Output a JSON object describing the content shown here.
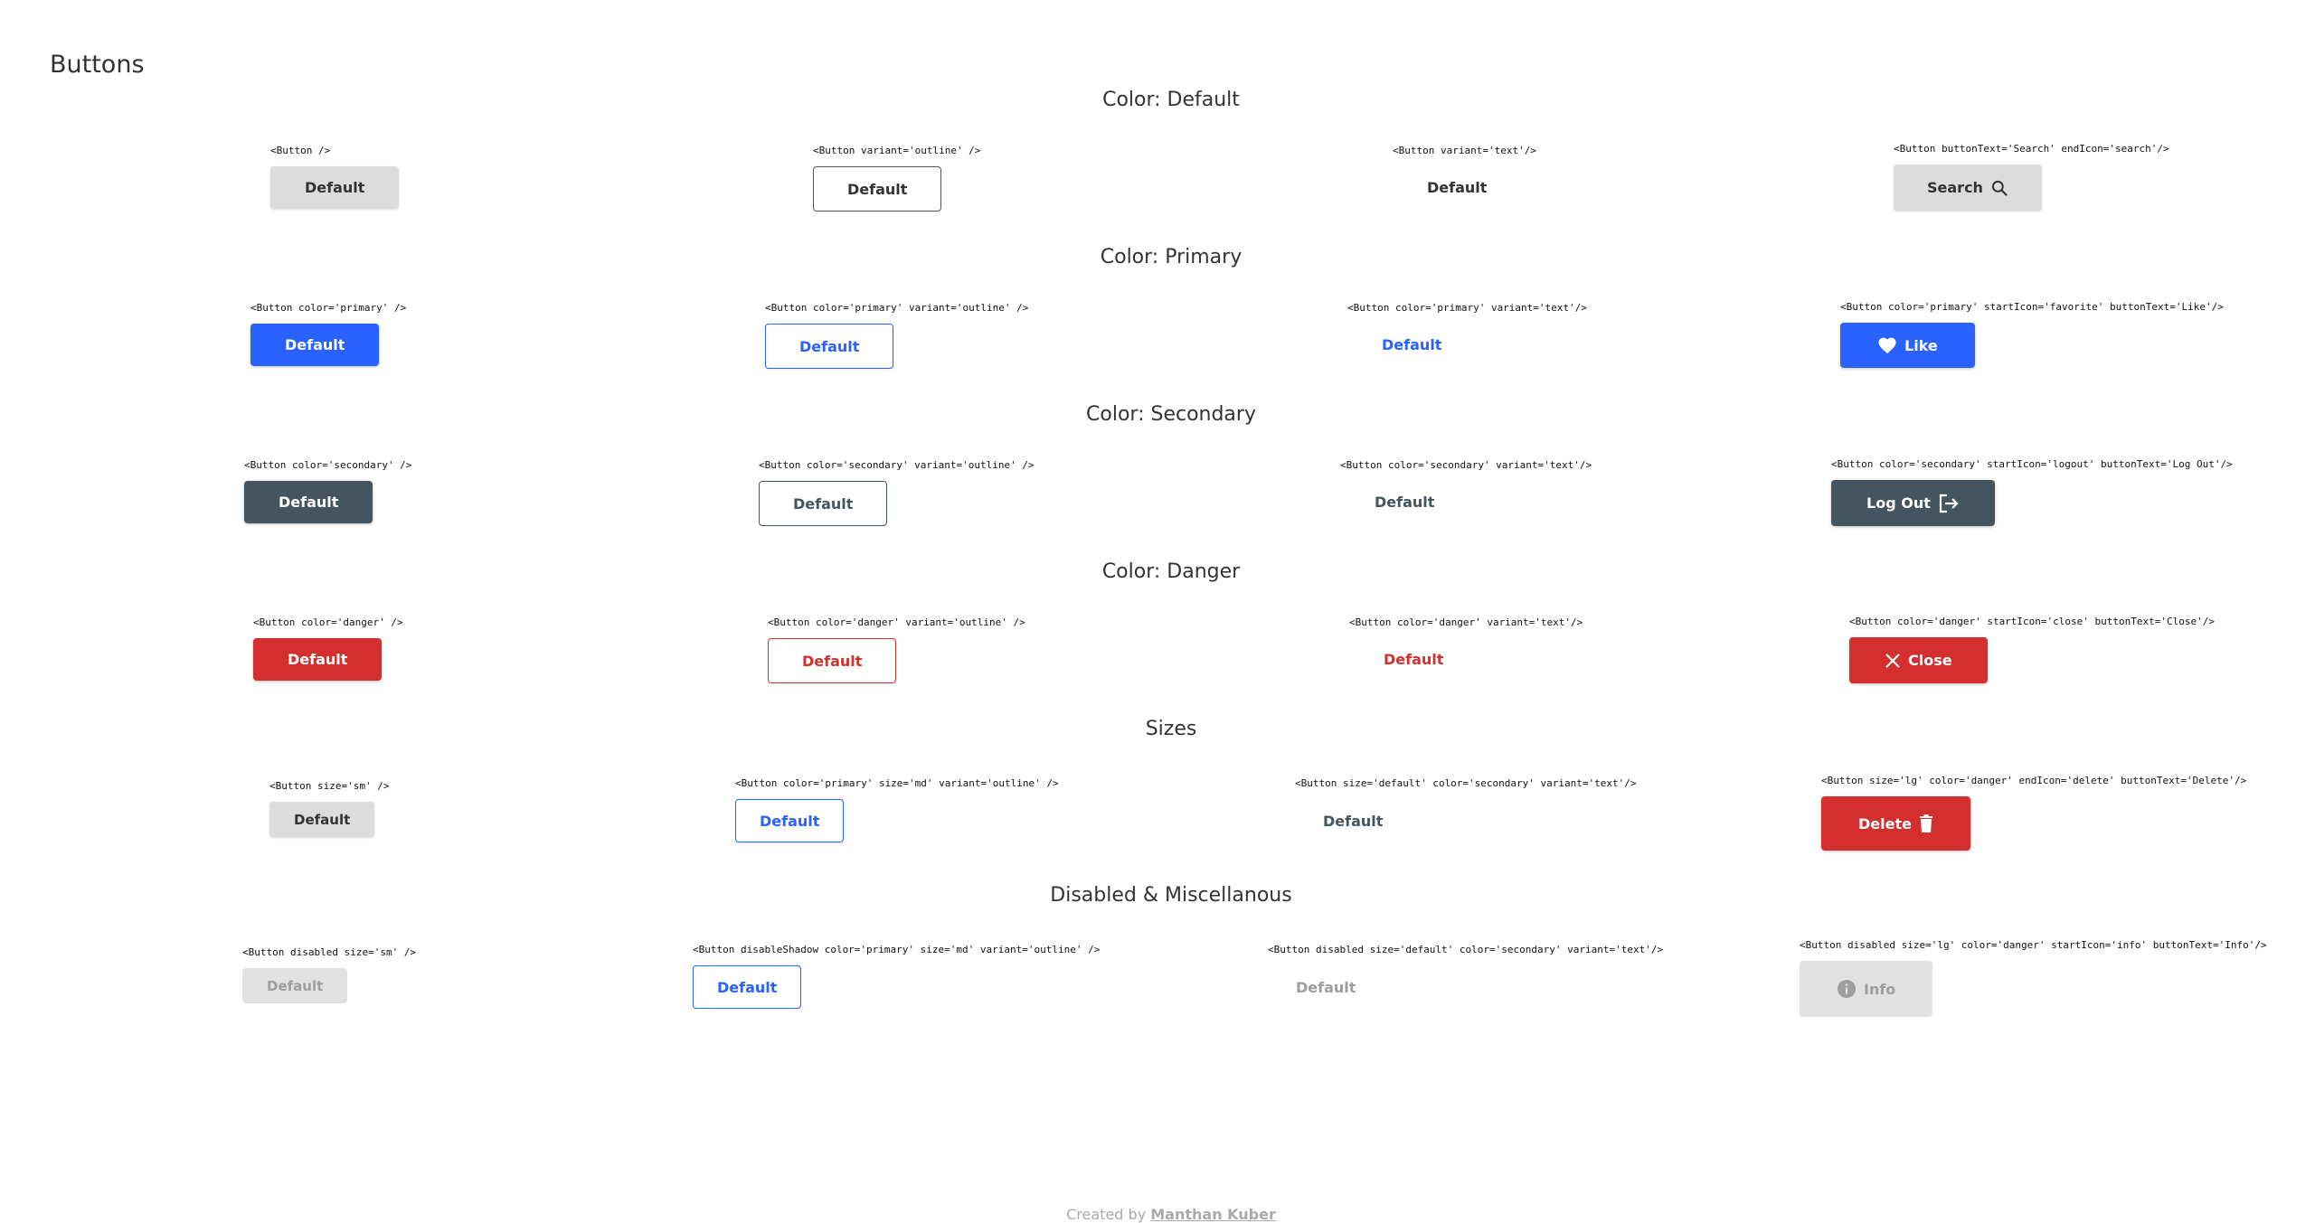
{
  "page_title": "Buttons",
  "sections": [
    {
      "title": "Color: Default",
      "buttons": [
        {
          "code": "<Button />",
          "label": "Default"
        },
        {
          "code": "<Button variant='outline' />",
          "label": "Default"
        },
        {
          "code": "<Button variant='text'/>",
          "label": "Default"
        },
        {
          "code": "<Button buttonText='Search' endIcon='search'/>",
          "label": "Search",
          "icon": "search-icon"
        }
      ]
    },
    {
      "title": "Color: Primary",
      "buttons": [
        {
          "code": "<Button color='primary' />",
          "label": "Default"
        },
        {
          "code": "<Button color='primary' variant='outline' />",
          "label": "Default"
        },
        {
          "code": "<Button color='primary' variant='text'/>",
          "label": "Default"
        },
        {
          "code": "<Button color='primary' startIcon='favorite' buttonText='Like'/>",
          "label": "Like",
          "icon": "heart-icon"
        }
      ]
    },
    {
      "title": "Color: Secondary",
      "buttons": [
        {
          "code": "<Button color='secondary' />",
          "label": "Default"
        },
        {
          "code": "<Button color='secondary' variant='outline' />",
          "label": "Default"
        },
        {
          "code": "<Button color='secondary' variant='text'/>",
          "label": "Default"
        },
        {
          "code": "<Button color='secondary' startIcon='logout' buttonText='Log Out'/>",
          "label": "Log Out",
          "icon": "logout-icon"
        }
      ]
    },
    {
      "title": "Color: Danger",
      "buttons": [
        {
          "code": "<Button color='danger' />",
          "label": "Default"
        },
        {
          "code": "<Button color='danger' variant='outline' />",
          "label": "Default"
        },
        {
          "code": "<Button color='danger' variant='text'/>",
          "label": "Default"
        },
        {
          "code": "<Button color='danger' startIcon='close' buttonText='Close'/>",
          "label": "Close",
          "icon": "close-icon"
        }
      ]
    },
    {
      "title": "Sizes",
      "buttons": [
        {
          "code": "<Button size='sm' />",
          "label": "Default"
        },
        {
          "code": "<Button color='primary' size='md' variant='outline' />",
          "label": "Default"
        },
        {
          "code": "<Button size='default' color='secondary' variant='text'/>",
          "label": "Default"
        },
        {
          "code": "<Button size='lg' color='danger' endIcon='delete' buttonText='Delete'/>",
          "label": "Delete",
          "icon": "trash-icon"
        }
      ]
    },
    {
      "title": "Disabled & Miscellanous",
      "buttons": [
        {
          "code": "<Button disabled size='sm' />",
          "label": "Default"
        },
        {
          "code": "<Button disableShadow color='primary' size='md' variant='outline' />",
          "label": "Default"
        },
        {
          "code": "<Button disabled size='default' color='secondary' variant='text'/>",
          "label": "Default"
        },
        {
          "code": "<Button disabled size='lg' color='danger' startIcon='info' buttonText='Info'/>",
          "label": "Info",
          "icon": "info-icon"
        }
      ]
    }
  ],
  "footer": {
    "prefix": "Created by",
    "author": "Manthan Kuber"
  },
  "colors": {
    "default_fill": "#dcdcdc",
    "primary": "#2962ff",
    "secondary": "#455560",
    "danger": "#d32f2f",
    "disabled_fill": "#e2e2e2",
    "disabled_text": "#9e9e9e"
  }
}
